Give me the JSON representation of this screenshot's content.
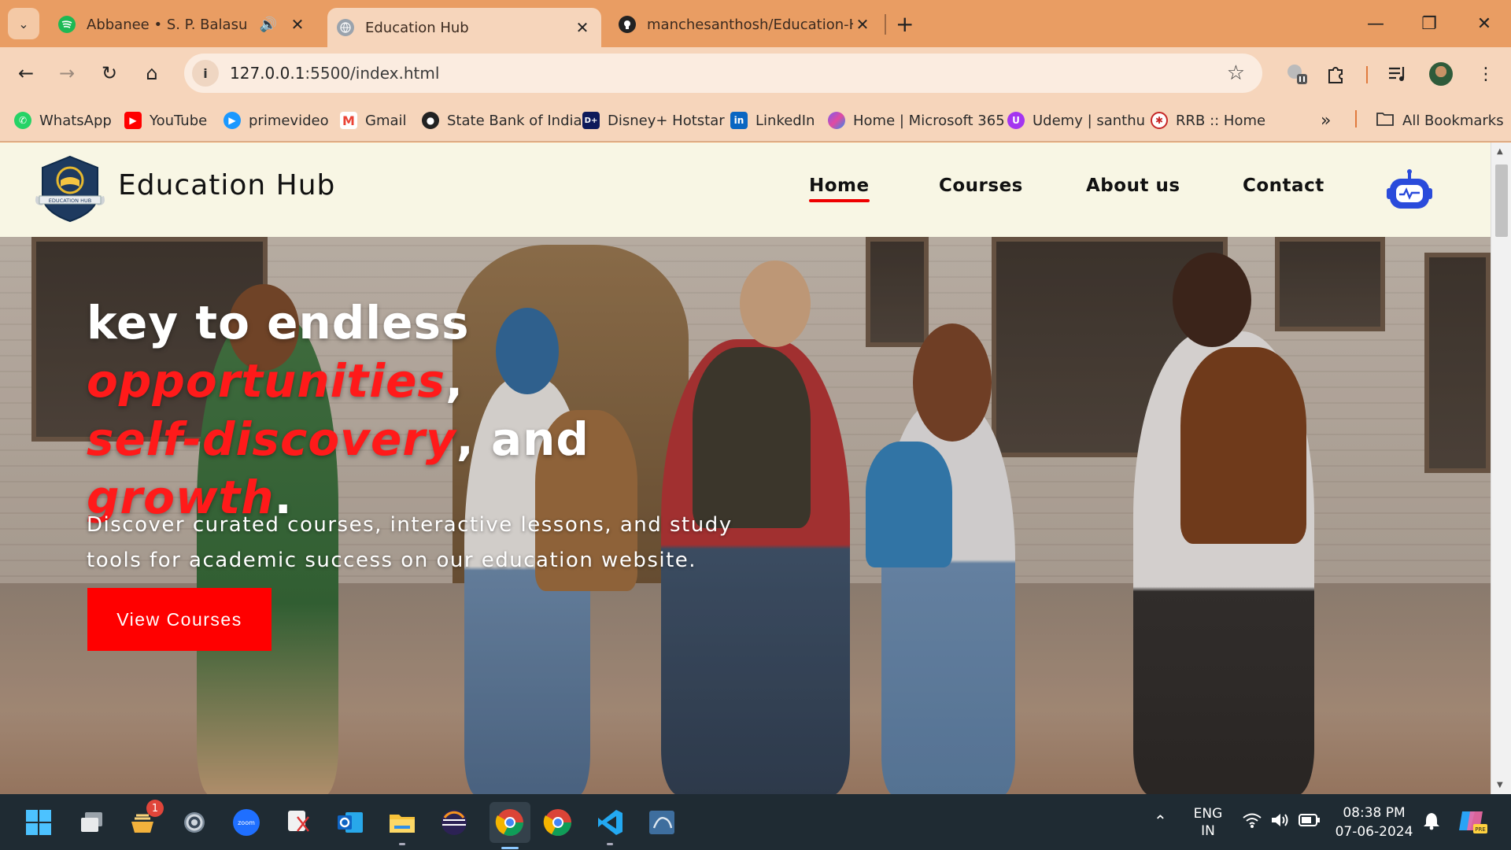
{
  "browser": {
    "tabs": [
      {
        "title": "Abbanee • S. P. Balasubrahmanyam",
        "favicon": "spotify-icon",
        "audio": true
      },
      {
        "title": "Education Hub",
        "favicon": "globe-icon",
        "active": true
      },
      {
        "title": "manchesanthosh/Education-Hub",
        "favicon": "github-icon"
      }
    ],
    "new_tab": "+",
    "url_host": "127.0.0.1",
    "url_rest": ":5500/index.html",
    "bookmarks": [
      {
        "label": "WhatsApp",
        "icon": "whatsapp-icon"
      },
      {
        "label": "YouTube",
        "icon": "youtube-icon"
      },
      {
        "label": "primevideo",
        "icon": "primevideo-icon"
      },
      {
        "label": "Gmail",
        "icon": "gmail-icon"
      },
      {
        "label": "State Bank of India",
        "icon": "sbi-icon"
      },
      {
        "label": "Disney+ Hotstar",
        "icon": "hotstar-icon"
      },
      {
        "label": "LinkedIn",
        "icon": "linkedin-icon"
      },
      {
        "label": "Home | Microsoft 365",
        "icon": "microsoft365-icon"
      },
      {
        "label": "Udemy | santhu",
        "icon": "udemy-icon"
      },
      {
        "label": "RRB :: Home",
        "icon": "rrb-icon"
      }
    ],
    "bookmarks_overflow": "»",
    "all_bookmarks": "All Bookmarks"
  },
  "site": {
    "brand": "Education Hub",
    "logo_text": "EDUCATION HUB",
    "nav": [
      "Home",
      "Courses",
      "About us",
      "Contact"
    ],
    "active_nav": "Home",
    "hero": {
      "title_1": "key to endless ",
      "title_hl_1": "opportunities",
      "title_2": ",",
      "title_hl_2": "self-discovery",
      "title_3": ", and",
      "title_hl_3": "growth",
      "title_4": ".",
      "subtitle": "Discover curated courses, interactive lessons, and study tools for academic success on our education website.",
      "cta": "View Courses"
    }
  },
  "taskbar": {
    "apps": [
      "start-icon",
      "task-view-icon",
      "tips-icon",
      "settings-icon",
      "zoom-icon",
      "snipping-tool-icon",
      "outlook-icon",
      "file-explorer-icon",
      "eclipse-icon",
      "chrome-icon",
      "chrome-dev-icon",
      "vscode-icon",
      "mysql-workbench-icon"
    ],
    "notification_badge": "1",
    "lang_1": "ENG",
    "lang_2": "IN",
    "time": "08:38 PM",
    "date": "07-06-2024"
  },
  "colors": {
    "accent_red": "#ff0000",
    "chrome_orange": "#e99d63",
    "header_bg": "#f8f6e4"
  }
}
